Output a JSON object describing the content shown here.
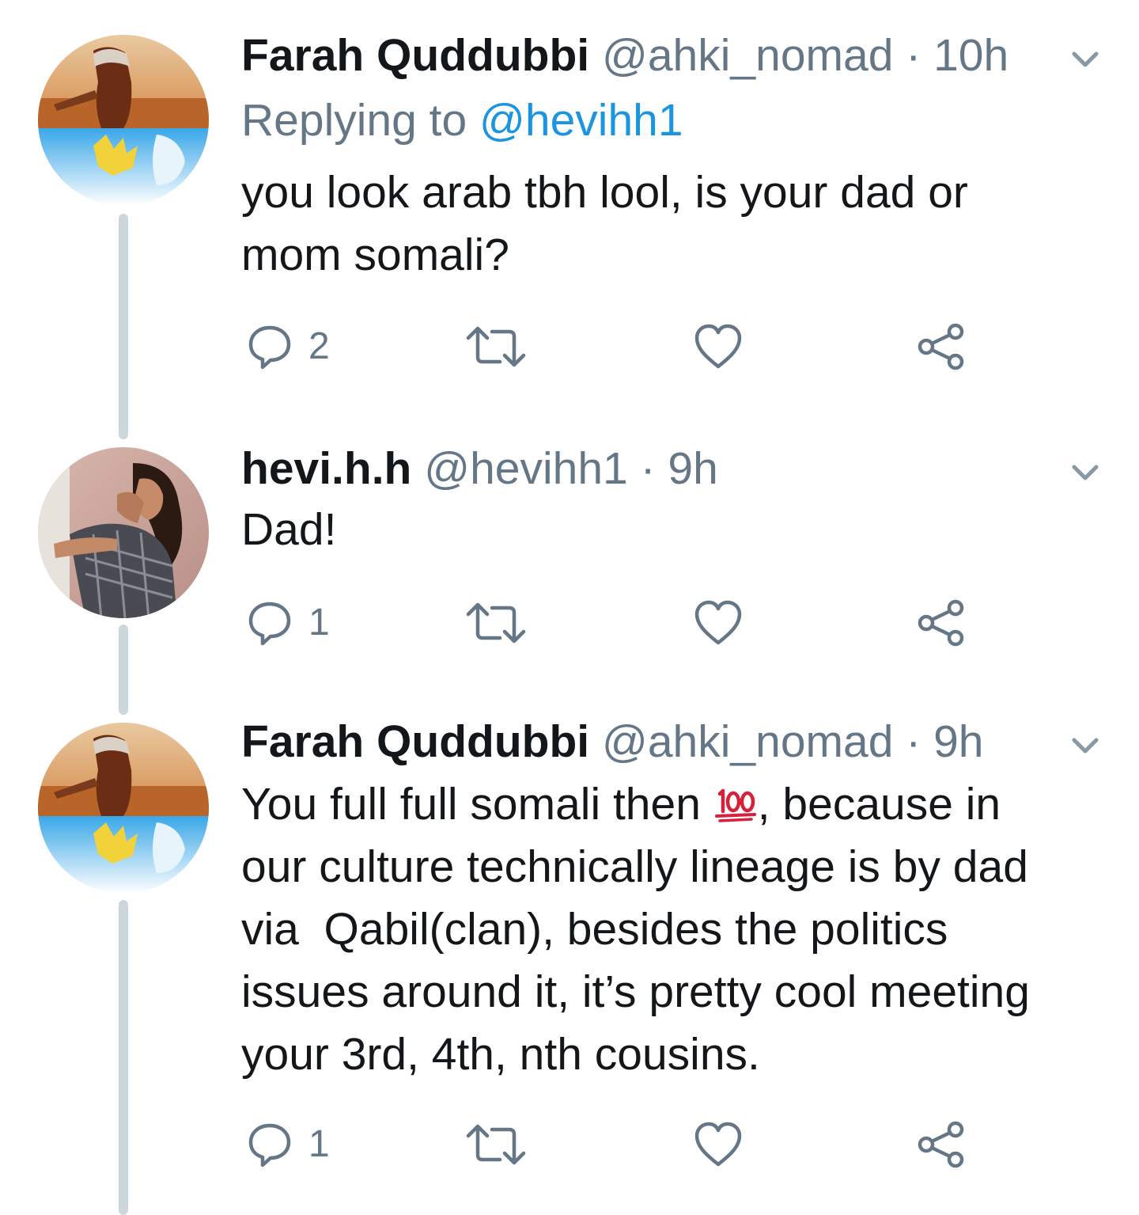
{
  "tweets": [
    {
      "name": "Farah Quddubbi",
      "handle": "@ahki_nomad",
      "separator": "·",
      "time": "10h",
      "replying_label": "Replying to",
      "replying_handle": "@hevihh1",
      "text_lines": [
        "you look arab tbh lool, is your dad or",
        "mom somali?"
      ],
      "reply_count": "2"
    },
    {
      "name": "hevi.h.h",
      "handle": "@hevihh1",
      "separator": "·",
      "time": "9h",
      "text_lines": [
        "Dad!"
      ],
      "reply_count": "1"
    },
    {
      "name": "Farah Quddubbi",
      "handle": "@ahki_nomad",
      "separator": "·",
      "time": "9h",
      "text_line1_before_emoji": "You full full somali then ",
      "text_line1_after_emoji": ", because in",
      "text_lines_rest": [
        "our culture technically lineage is by dad",
        "via  Qabil(clan), besides the politics",
        "issues around it, it’s pretty cool meeting",
        "your 3rd, 4th, nth cousins."
      ],
      "reply_count": "1"
    }
  ],
  "icons": {
    "reply": "reply-icon",
    "retweet": "retweet-icon",
    "like": "heart-icon",
    "share": "share-icon",
    "caret": "chevron-down-icon",
    "emoji": "hundred-points-emoji"
  },
  "colors": {
    "text": "#14171a",
    "secondary": "#657786",
    "link": "#1b95e0",
    "thread_line": "#ccd6dd",
    "emoji_red": "#d6213c"
  }
}
